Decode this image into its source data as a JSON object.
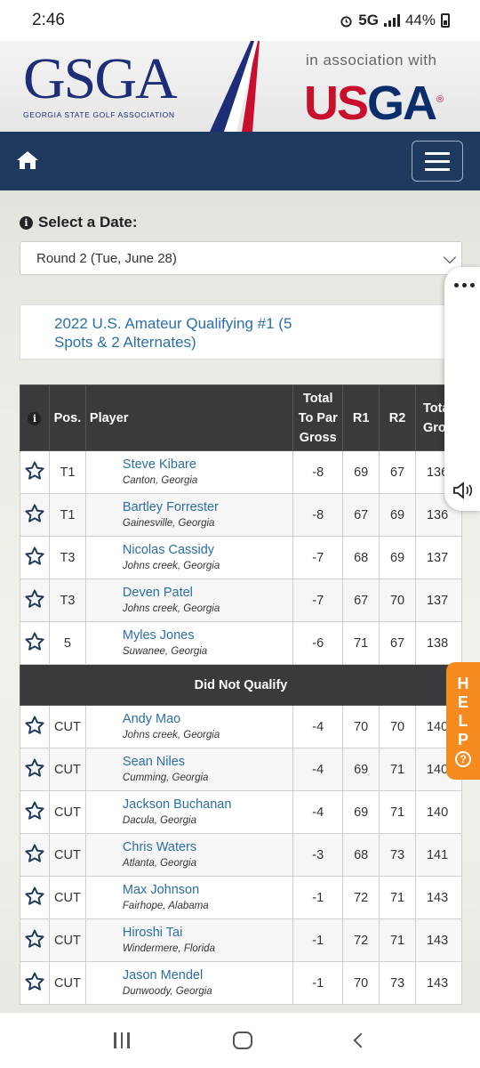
{
  "status": {
    "time": "2:46",
    "network": "5G",
    "battery": "44%"
  },
  "banner": {
    "gsga_logo": "GSGA",
    "gsga_subtitle": "GEORGIA STATE GOLF ASSOCIATION",
    "association_text": "in association with",
    "usga_logo_us": "US",
    "usga_logo_ga": "GA",
    "usga_reg": "®"
  },
  "date_selector": {
    "label": "Select a Date:",
    "selected": "Round 2 (Tue, June 28)"
  },
  "event": {
    "title_line1": "2022 U.S. Amateur Qualifying #1 (5",
    "title_line2": "Spots & 2 Alternates)"
  },
  "table": {
    "headers": {
      "pos": "Pos.",
      "player": "Player",
      "topar_l1": "Total",
      "topar_l2": "To Par",
      "topar_l3": "Gross",
      "r1": "R1",
      "r2": "R2",
      "total_l1": "Total",
      "total_l2": "Gross"
    },
    "qualifiers": [
      {
        "pos": "T1",
        "name": "Steve Kibare",
        "location": "Canton, Georgia",
        "to_par": "-8",
        "r1": "69",
        "r2": "67",
        "total": "136"
      },
      {
        "pos": "T1",
        "name": "Bartley Forrester",
        "location": "Gainesville, Georgia",
        "to_par": "-8",
        "r1": "67",
        "r2": "69",
        "total": "136"
      },
      {
        "pos": "T3",
        "name": "Nicolas Cassidy",
        "location": "Johns creek, Georgia",
        "to_par": "-7",
        "r1": "68",
        "r2": "69",
        "total": "137"
      },
      {
        "pos": "T3",
        "name": "Deven Patel",
        "location": "Johns creek, Georgia",
        "to_par": "-7",
        "r1": "67",
        "r2": "70",
        "total": "137"
      },
      {
        "pos": "5",
        "name": "Myles Jones",
        "location": "Suwanee, Georgia",
        "to_par": "-6",
        "r1": "71",
        "r2": "67",
        "total": "138"
      }
    ],
    "section_label": "Did Not Qualify",
    "non_qualifiers": [
      {
        "pos": "CUT",
        "name": "Andy Mao",
        "location": "Johns creek, Georgia",
        "to_par": "-4",
        "r1": "70",
        "r2": "70",
        "total": "140"
      },
      {
        "pos": "CUT",
        "name": "Sean Niles",
        "location": "Cumming, Georgia",
        "to_par": "-4",
        "r1": "69",
        "r2": "71",
        "total": "140"
      },
      {
        "pos": "CUT",
        "name": "Jackson Buchanan",
        "location": "Dacula, Georgia",
        "to_par": "-4",
        "r1": "69",
        "r2": "71",
        "total": "140"
      },
      {
        "pos": "CUT",
        "name": "Chris Waters",
        "location": "Atlanta, Georgia",
        "to_par": "-3",
        "r1": "68",
        "r2": "73",
        "total": "141"
      },
      {
        "pos": "CUT",
        "name": "Max Johnson",
        "location": "Fairhope, Alabama",
        "to_par": "-1",
        "r1": "72",
        "r2": "71",
        "total": "143"
      },
      {
        "pos": "CUT",
        "name": "Hiroshi Tai",
        "location": "Windermere, Florida",
        "to_par": "-1",
        "r1": "72",
        "r2": "71",
        "total": "143"
      },
      {
        "pos": "CUT",
        "name": "Jason Mendel",
        "location": "Dunwoody, Georgia",
        "to_par": "-1",
        "r1": "70",
        "r2": "73",
        "total": "143"
      }
    ]
  },
  "help_tab": {
    "letters": [
      "H",
      "E",
      "L",
      "P"
    ],
    "icon": "?"
  },
  "icons": {
    "home": "home-icon",
    "menu": "hamburger-menu-icon",
    "info": "info-icon",
    "star": "star-outline-icon",
    "more": "more-dots-icon",
    "speaker": "speaker-icon"
  },
  "colors": {
    "navbar": "#1e3a5f",
    "link": "#2a6fa8",
    "table_header": "#3a3a3c",
    "help": "#f58a1f",
    "gsga_blue": "#1d2d78",
    "usga_red": "#c8102e"
  }
}
